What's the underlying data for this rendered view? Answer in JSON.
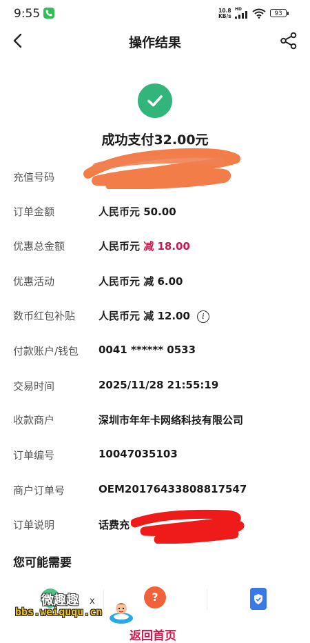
{
  "status_bar": {
    "time": "9:55",
    "net_speed_value": "10.8",
    "net_speed_unit": "KB/s",
    "hd": "HD",
    "battery": "93"
  },
  "header": {
    "title": "操作结果"
  },
  "result": {
    "message": "成功支付32.00元"
  },
  "details": [
    {
      "label": "充值号码",
      "value": ""
    },
    {
      "label": "订单金额",
      "value": "人民币元 50.00"
    },
    {
      "label": "优惠总金额",
      "prefix": "人民币元 ",
      "highlight": "减 18.00"
    },
    {
      "label": "优惠活动",
      "value": "人民币元 减 6.00"
    },
    {
      "label": "数币红包补贴",
      "value": "人民币元 减 12.00",
      "info": "i"
    },
    {
      "label": "付款账户/钱包",
      "value": "0041 ****** 0533"
    },
    {
      "label": "交易时间",
      "value": "2025/11/28 21:55:19"
    },
    {
      "label": "收款商户",
      "value": "深圳市年年卡网络科技有限公司"
    },
    {
      "label": "订单编号",
      "value": "10047035103"
    },
    {
      "label": "商户订单号",
      "value": "OEM20176433808817547"
    },
    {
      "label": "订单说明",
      "value": "话费充"
    }
  ],
  "recommend": {
    "title": "您可能需要",
    "icons": [
      "service-green-icon",
      "help-question-icon",
      "shield-phone-icon"
    ]
  },
  "watermark": {
    "title": "微趣趣",
    "url": "bbs.weiququ.cn",
    "x_mark": "x"
  },
  "footer": {
    "return_label": "返回首页"
  },
  "colors": {
    "success": "#31b57a",
    "discount_red": "#c7194d",
    "scribble_orange": "#f2733a",
    "scribble_red": "#ef1a1a"
  }
}
